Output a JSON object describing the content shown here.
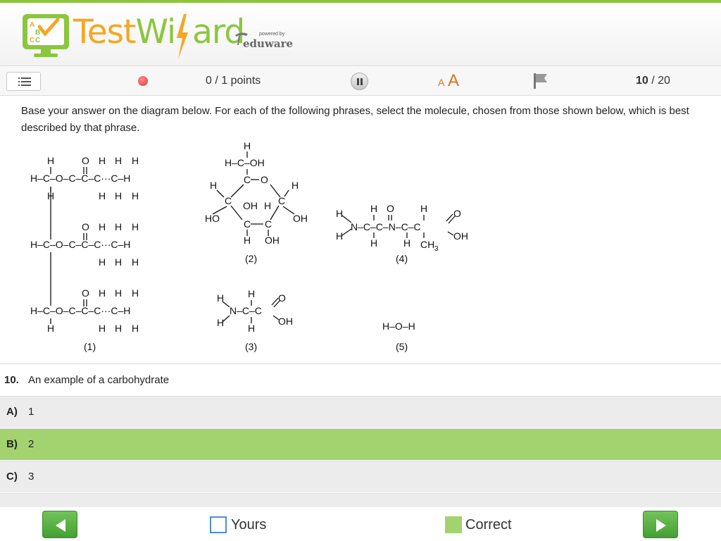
{
  "app": {
    "logo_test": "Test",
    "logo_wizard_1": "Wi",
    "logo_wizard_2": "ard",
    "powered_by": "powered by",
    "brand": "eduware",
    "accent_color": "#8cc63f"
  },
  "toolbar": {
    "points": "0 / 1 points",
    "font_small": "A",
    "font_large": "A",
    "page_current": "10",
    "page_total": " / 20"
  },
  "question": {
    "instructions": "Base your answer on the diagram below. For each of the following phrases, select the molecule, chosen from those shown below, which is best described by that phrase.",
    "number": "10.",
    "stem": "An example of a carbohydrate"
  },
  "diagram": {
    "labels": [
      "(1)",
      "(2)",
      "(3)",
      "(4)",
      "(5)"
    ],
    "water": "H–O–H"
  },
  "choices": [
    {
      "letter": "A)",
      "text": "1",
      "state": "normal"
    },
    {
      "letter": "B)",
      "text": "2",
      "state": "correct"
    },
    {
      "letter": "C)",
      "text": "3",
      "state": "normal"
    }
  ],
  "footer": {
    "yours_label": "Yours",
    "correct_label": "Correct",
    "yours_color": "#4a90d9",
    "correct_color": "#a3d36f"
  }
}
